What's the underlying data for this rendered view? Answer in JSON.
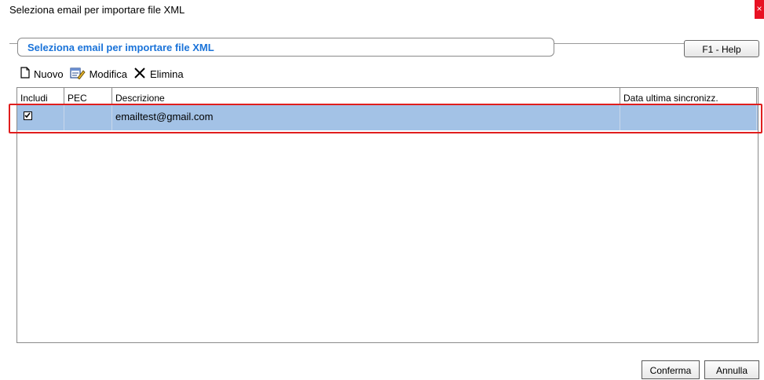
{
  "window": {
    "title": "Seleziona email per importare file XML"
  },
  "header": {
    "title": "Seleziona email per importare file XML",
    "help_label": "F1 - Help"
  },
  "toolbar": {
    "new_label": "Nuovo",
    "edit_label": "Modifica",
    "delete_label": "Elimina"
  },
  "table": {
    "columns": [
      "Includi",
      "PEC",
      "Descrizione",
      "Data ultima sincronizz."
    ],
    "rows": [
      {
        "included": true,
        "pec": "",
        "description": "emailtest@gmail.com",
        "last_sync": ""
      }
    ]
  },
  "footer": {
    "confirm_label": "Conferma",
    "cancel_label": "Annulla"
  },
  "colors": {
    "accent": "#1a73d9",
    "selection": "#a3c2e6",
    "highlight": "#e01e1e"
  }
}
